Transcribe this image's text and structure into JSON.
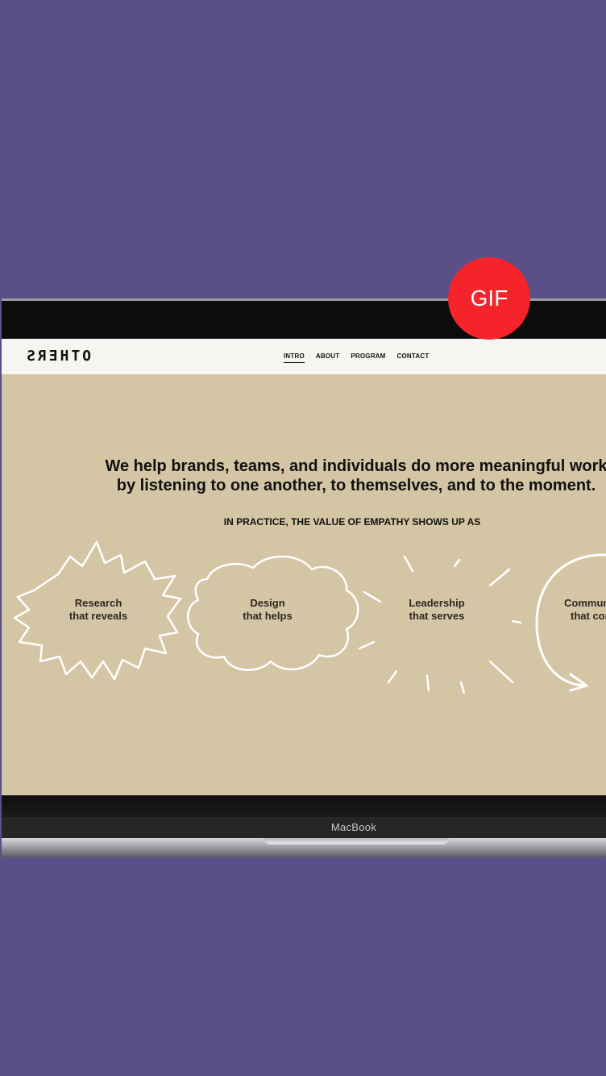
{
  "badge": {
    "label": "GIF"
  },
  "site": {
    "logo": "OTHERS",
    "nav": [
      "INTRO",
      "ABOUT",
      "PROGRAM",
      "CONTACT"
    ],
    "headline_line1": "We help brands, teams, and individuals do more meaningful work",
    "headline_line2": "by listening to one another, to themselves, and to the moment.",
    "subhead": "IN PRACTICE, THE VALUE OF EMPATHY SHOWS UP AS",
    "values": [
      {
        "line1": "Research",
        "line2": "that reveals"
      },
      {
        "line1": "Design",
        "line2": "that helps"
      },
      {
        "line1": "Leadership",
        "line2": "that serves"
      },
      {
        "line1": "Community",
        "line2": "that connects"
      }
    ]
  },
  "device": {
    "label": "MacBook"
  },
  "colors": {
    "background": "#5a4f88",
    "screen": "#d4c5a5",
    "navbar": "#f6f5f1",
    "badge": "#f5242b"
  }
}
